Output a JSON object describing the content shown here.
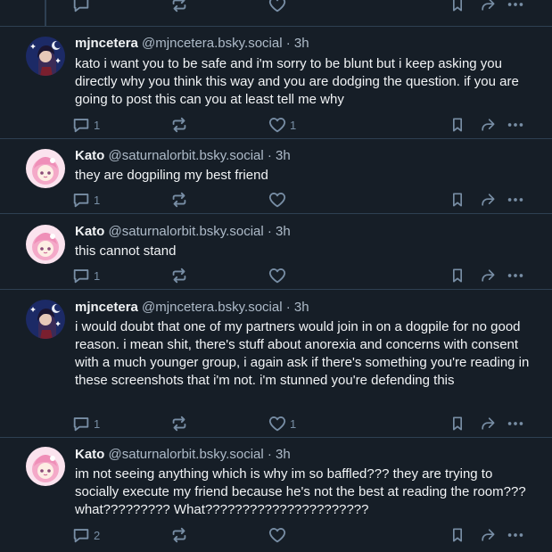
{
  "theme": {
    "background": "#161e27",
    "border": "#2e4052",
    "text_primary": "#f1f3f5",
    "text_secondary": "#aebbc9",
    "icon": "#788ea5"
  },
  "posts": [
    {
      "author_name": "mjncetera",
      "author_handle": "@mjncetera.bsky.social",
      "separator": " · ",
      "time": "3h",
      "avatar": "mjncetera-avatar",
      "text": "kato i want you to be safe and i'm sorry to be blunt but i keep asking you directly why you think this way and you are dodging the question. if you are going to post this can you at least tell me why",
      "reply_count": "1",
      "repost_count": "",
      "like_count": "1"
    },
    {
      "author_name": "Kato",
      "author_handle": "@saturnalorbit.bsky.social",
      "separator": " · ",
      "time": "3h",
      "avatar": "kato-avatar",
      "text": "they are dogpiling my best friend",
      "reply_count": "1",
      "repost_count": "",
      "like_count": ""
    },
    {
      "author_name": "Kato",
      "author_handle": "@saturnalorbit.bsky.social",
      "separator": " · ",
      "time": "3h",
      "avatar": "kato-avatar",
      "text": "this cannot stand",
      "reply_count": "1",
      "repost_count": "",
      "like_count": ""
    },
    {
      "author_name": "mjncetera",
      "author_handle": "@mjncetera.bsky.social",
      "separator": " · ",
      "time": "3h",
      "avatar": "mjncetera-avatar",
      "text": "i would doubt that one of my partners would join in on a dogpile for no good reason. i mean shit, there's stuff about anorexia and concerns with consent with a much younger group, i again ask if there's something you're reading in these screenshots that i'm not. i'm stunned you're defending this",
      "reply_count": "1",
      "repost_count": "",
      "like_count": "1"
    },
    {
      "author_name": "Kato",
      "author_handle": "@saturnalorbit.bsky.social",
      "separator": " · ",
      "time": "3h",
      "avatar": "kato-avatar",
      "text": "im not seeing anything which is why im so baffled??? they are trying to socially execute my friend because he's not the best at reading the room??? what????????? What??????????????????????",
      "reply_count": "2",
      "repost_count": "",
      "like_count": ""
    }
  ]
}
